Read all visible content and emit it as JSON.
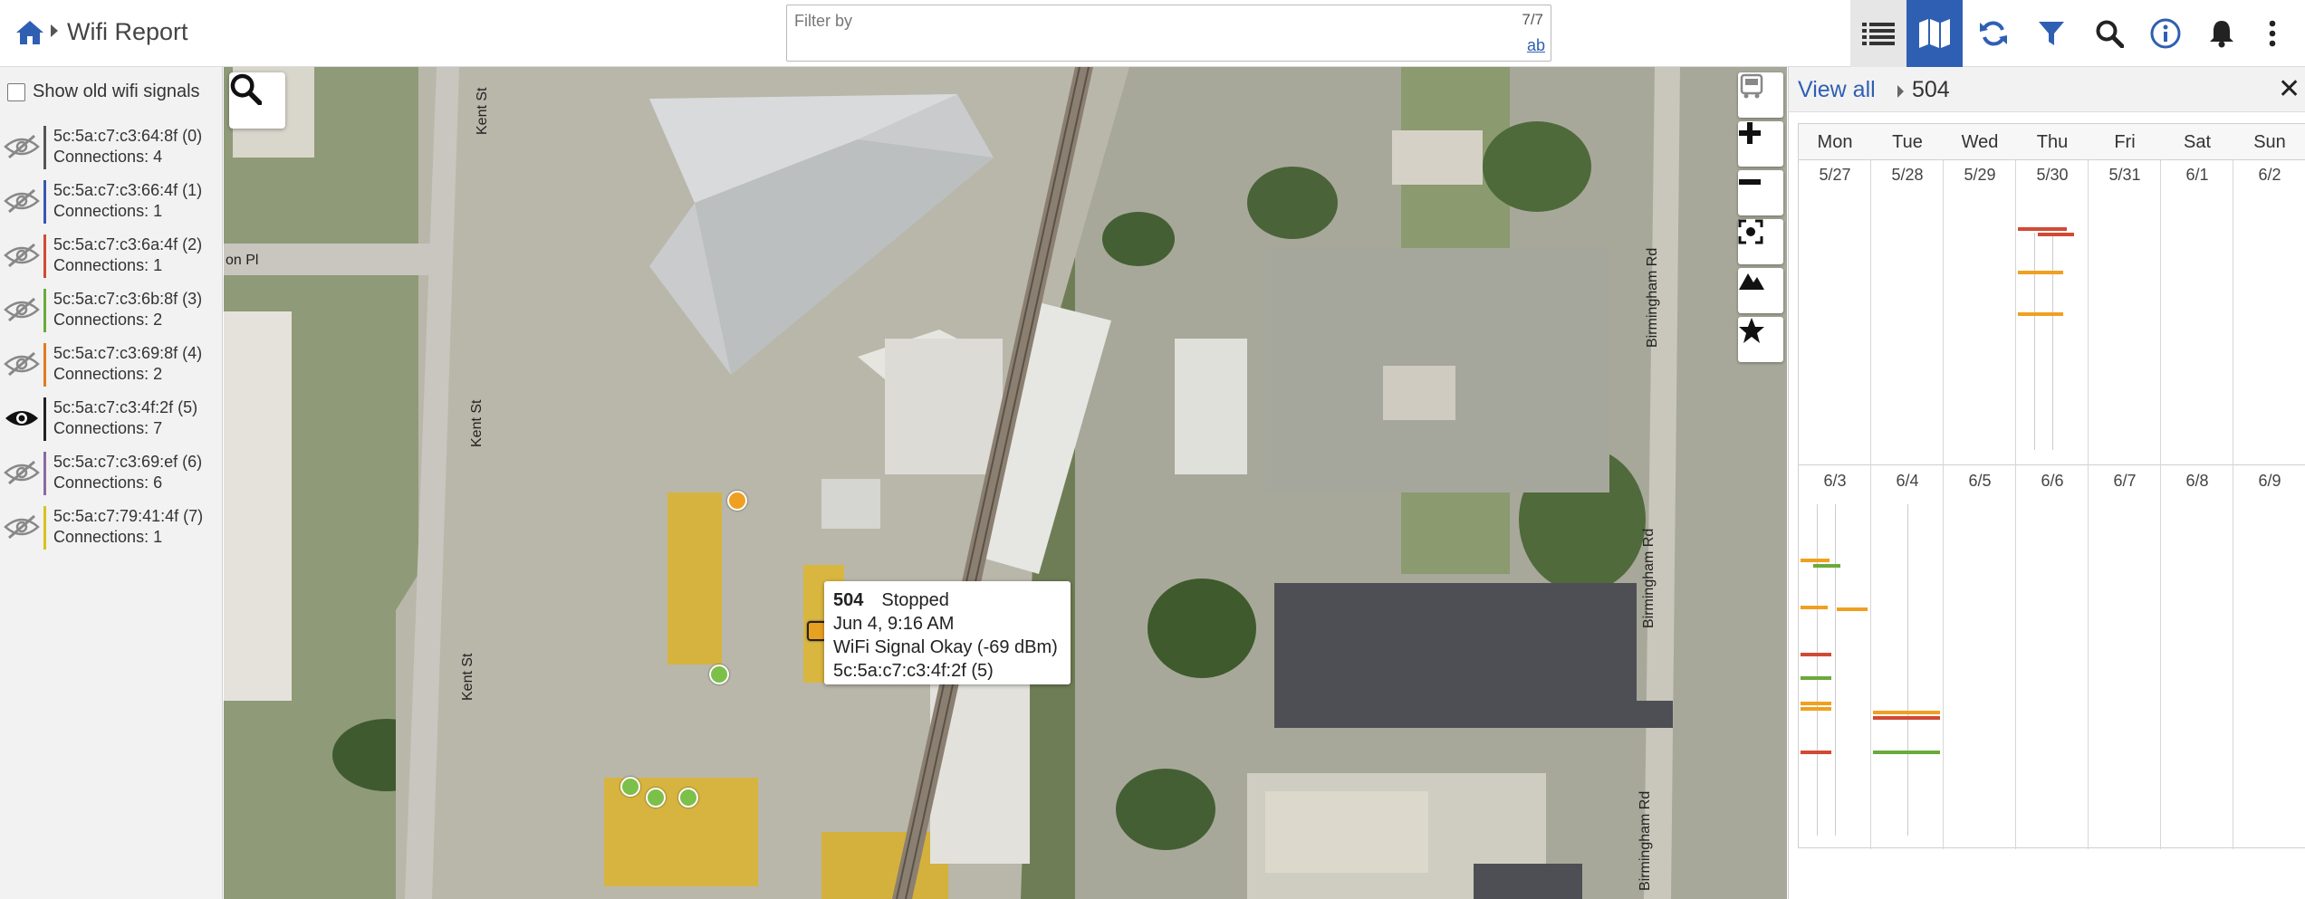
{
  "header": {
    "title": "Wifi Report",
    "filter": {
      "placeholder": "Filter by",
      "count": "7/7",
      "mode": "ab"
    }
  },
  "toolbar": {
    "buttons": [
      "list-icon",
      "map-icon",
      "refresh-icon",
      "filter-icon",
      "search-icon",
      "info-icon",
      "bell-icon",
      "more-icon"
    ],
    "active": "map"
  },
  "left_panel": {
    "show_old_label": "Show old wifi signals",
    "show_old_checked": false,
    "signals": [
      {
        "name": "5c:5a:c7:c3:64:8f (0)",
        "connections": "Connections: 4",
        "color": "#555555",
        "visible": false
      },
      {
        "name": "5c:5a:c7:c3:66:4f (1)",
        "connections": "Connections: 1",
        "color": "#3a56b0",
        "visible": false
      },
      {
        "name": "5c:5a:c7:c3:6a:4f (2)",
        "connections": "Connections: 1",
        "color": "#d14b34",
        "visible": false
      },
      {
        "name": "5c:5a:c7:c3:6b:8f (3)",
        "connections": "Connections: 2",
        "color": "#6aaa3a",
        "visible": false
      },
      {
        "name": "5c:5a:c7:c3:69:8f (4)",
        "connections": "Connections: 2",
        "color": "#e07b22",
        "visible": false
      },
      {
        "name": "5c:5a:c7:c3:4f:2f (5)",
        "connections": "Connections: 7",
        "color": "#222222",
        "visible": true
      },
      {
        "name": "5c:5a:c7:c3:69:ef (6)",
        "connections": "Connections: 6",
        "color": "#8a6aa0",
        "visible": false
      },
      {
        "name": "5c:5a:c7:79:41:4f (7)",
        "connections": "Connections: 1",
        "color": "#d8c21e",
        "visible": false
      }
    ]
  },
  "map": {
    "street_labels": [
      "Kent St",
      "Kent St",
      "Kent St",
      "on Pl",
      "Birmingham Rd",
      "Birmingham Rd",
      "Birmingham Rd"
    ],
    "popup": {
      "unit": "504",
      "status": "Stopped",
      "time": "Jun 4, 9:16 AM",
      "signal": "WiFi Signal Okay (-69 dBm)",
      "mac": "5c:5a:c7:c3:4f:2f (5)"
    },
    "controls": [
      "bus-icon",
      "plus-icon",
      "minus-icon",
      "fit-icon",
      "terrain-icon",
      "star-icon"
    ],
    "marker_colors": {
      "orange": "#f0a020",
      "green": "#7cc04a",
      "selected": "#e8a020"
    }
  },
  "calendar": {
    "view_all": "View all",
    "unit": "504",
    "days": [
      "Mon",
      "Tue",
      "Wed",
      "Thu",
      "Fri",
      "Sat",
      "Sun"
    ],
    "weeks": [
      [
        "5/27",
        "5/28",
        "5/29",
        "5/30",
        "5/31",
        "6/1",
        "6/2"
      ],
      [
        "6/3",
        "6/4",
        "6/5",
        "6/6",
        "6/7",
        "6/8",
        "6/9"
      ]
    ]
  }
}
